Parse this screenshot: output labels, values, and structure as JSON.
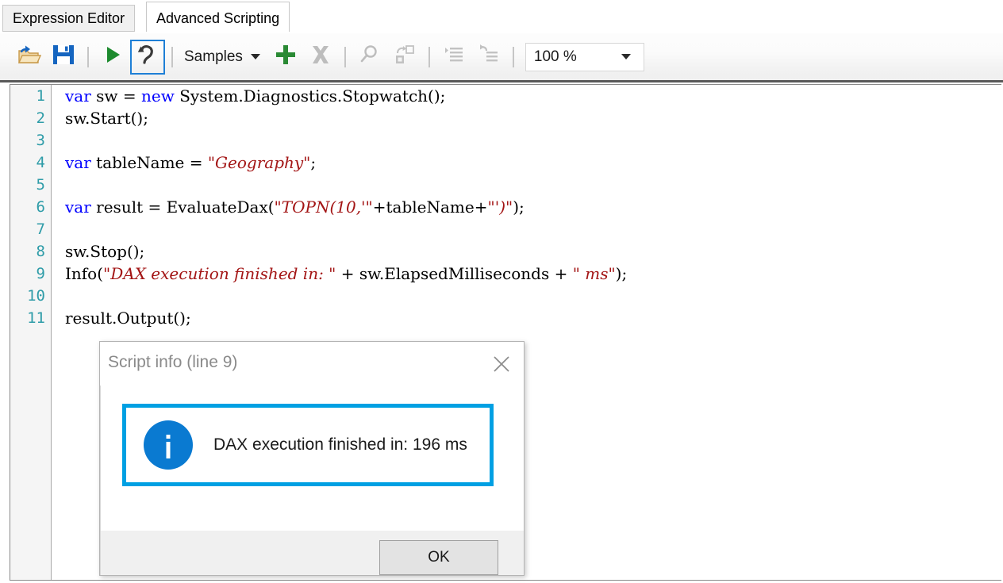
{
  "window": {
    "tabs": [
      {
        "label": "Expression Editor",
        "active": false
      },
      {
        "label": "Advanced Scripting",
        "active": true
      }
    ]
  },
  "toolbar": {
    "open_label": "Open",
    "save_label": "Save",
    "run_label": "Run",
    "undo_label": "Undo",
    "samples_label": "Samples",
    "add_label": "Add",
    "delete_label": "Delete",
    "find_label": "Find",
    "replace_label": "Replace",
    "indent_label": "Indent",
    "outdent_label": "Outdent",
    "zoom_value": "100 %",
    "icons": {
      "open": "open-folder-icon",
      "save": "save-floppy-icon",
      "run": "play-triangle-icon",
      "undo": "undo-arrow-icon",
      "samples_caret": "chevron-down-icon",
      "add": "plus-icon",
      "delete": "x-cross-icon",
      "find": "magnifier-icon",
      "replace": "replace-icon",
      "indent": "indent-icon",
      "outdent": "outdent-icon",
      "zoom_caret": "chevron-down-icon"
    }
  },
  "editor": {
    "gutter": [
      "1",
      "2",
      "3",
      "4",
      "5",
      "6",
      "7",
      "8",
      "9",
      "10",
      "11"
    ],
    "lines": [
      [
        {
          "t": "var",
          "c": "kw"
        },
        {
          "t": " sw = ",
          "c": ""
        },
        {
          "t": "new",
          "c": "kw"
        },
        {
          "t": " System.Diagnostics.Stopwatch();",
          "c": ""
        }
      ],
      [
        {
          "t": "sw.Start();",
          "c": ""
        }
      ],
      [
        {
          "t": "",
          "c": ""
        }
      ],
      [
        {
          "t": "var",
          "c": "kw"
        },
        {
          "t": " tableName = ",
          "c": ""
        },
        {
          "t": "\"Geography\"",
          "c": "str"
        },
        {
          "t": ";",
          "c": ""
        }
      ],
      [
        {
          "t": "",
          "c": ""
        }
      ],
      [
        {
          "t": "var",
          "c": "kw"
        },
        {
          "t": " result = EvaluateDax(",
          "c": ""
        },
        {
          "t": "\"TOPN(10,'\"",
          "c": "str"
        },
        {
          "t": "+tableName+",
          "c": ""
        },
        {
          "t": "\"')\"",
          "c": "str"
        },
        {
          "t": ");",
          "c": ""
        }
      ],
      [
        {
          "t": "",
          "c": ""
        }
      ],
      [
        {
          "t": "sw.Stop();",
          "c": ""
        }
      ],
      [
        {
          "t": "Info(",
          "c": ""
        },
        {
          "t": "\"DAX execution finished in: \"",
          "c": "str"
        },
        {
          "t": " + sw.ElapsedMilliseconds + ",
          "c": ""
        },
        {
          "t": "\" ms\"",
          "c": "str"
        },
        {
          "t": ");",
          "c": ""
        }
      ],
      [
        {
          "t": "",
          "c": ""
        }
      ],
      [
        {
          "t": "result.Output();",
          "c": ""
        }
      ]
    ]
  },
  "dialog": {
    "title": "Script info (line 9)",
    "close_icon": "close-x-icon",
    "info_icon": "info-circle-icon",
    "message": "DAX execution finished in: 196 ms",
    "ok_label": "OK",
    "accent_color": "#00a0e3",
    "info_icon_color": "#0a7ad1"
  }
}
